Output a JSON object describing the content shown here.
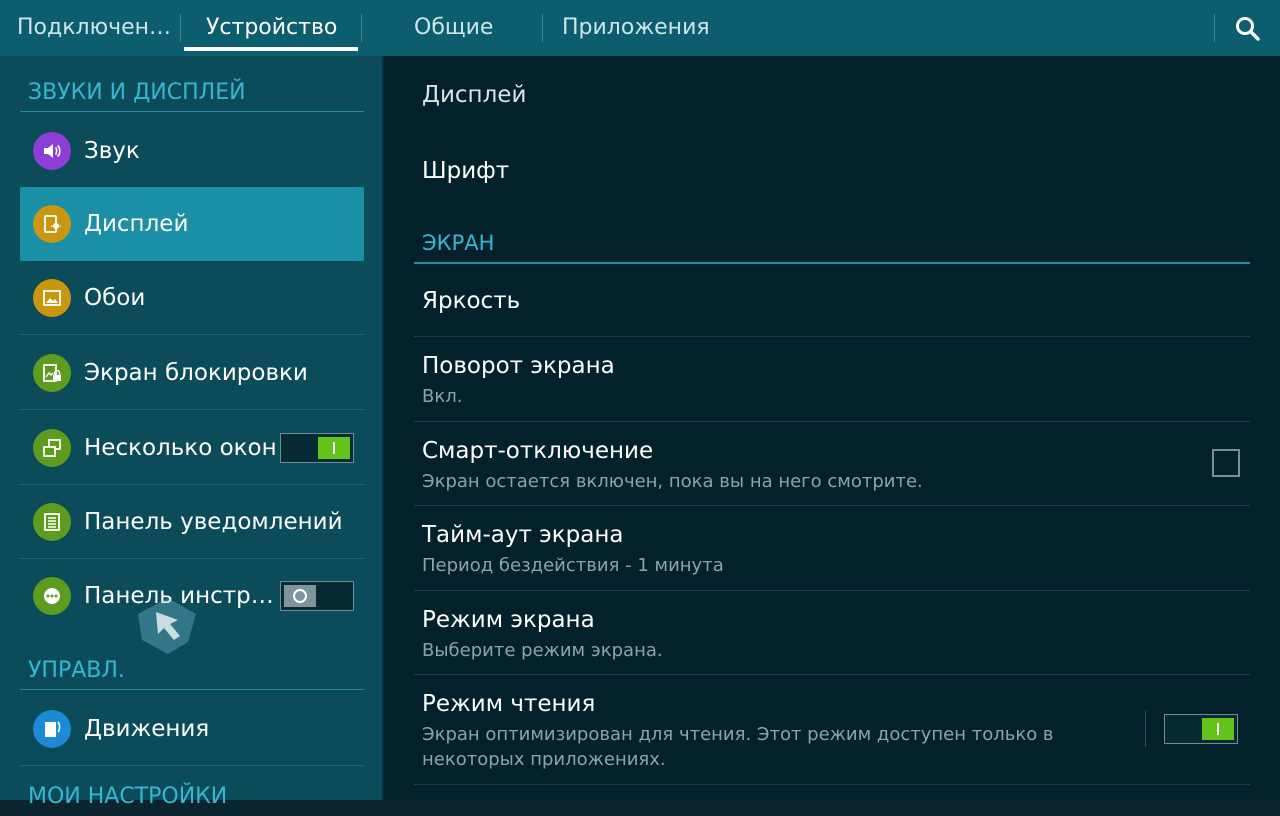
{
  "tabs": [
    {
      "label": "Подключен…",
      "active": false
    },
    {
      "label": "Устройство",
      "active": true
    },
    {
      "label": "Общие",
      "active": false
    },
    {
      "label": "Приложения",
      "active": false
    }
  ],
  "search_icon": "search-icon",
  "sidebar": {
    "sections": [
      "ЗВУКИ И ДИСПЛЕЙ",
      "УПРАВЛ.",
      "МОИ НАСТРОЙКИ"
    ],
    "items": [
      {
        "label": "Звук",
        "icon": "speaker-icon",
        "icon_color": "#8e3ed6"
      },
      {
        "label": "Дисплей",
        "icon": "display-icon",
        "icon_color": "#c9960f",
        "active": true
      },
      {
        "label": "Обои",
        "icon": "wallpaper-icon",
        "icon_color": "#c9960f"
      },
      {
        "label": "Экран блокировки",
        "icon": "lock-screen-icon",
        "icon_color": "#5e9b1e"
      },
      {
        "label": "Несколько окон",
        "icon": "multi-window-icon",
        "icon_color": "#5e9b1e",
        "switch": "on"
      },
      {
        "label": "Панель уведомлений",
        "icon": "notification-panel-icon",
        "icon_color": "#5e9b1e"
      },
      {
        "label": "Панель инстр…",
        "icon": "toolbox-icon",
        "icon_color": "#5e9b1e",
        "switch": "off"
      },
      {
        "label": "Движения",
        "icon": "motions-icon",
        "icon_color": "#1d8ad6"
      }
    ]
  },
  "main": {
    "items_top": [
      {
        "title": "Дисплей"
      },
      {
        "title": "Шрифт"
      }
    ],
    "section": "ЭКРАН",
    "settings": [
      {
        "title": "Яркость",
        "subtitle": ""
      },
      {
        "title": "Поворот экрана",
        "subtitle": "Вкл."
      },
      {
        "title": "Смарт-отключение",
        "subtitle": "Экран остается включен, пока вы на него смотрите.",
        "checkbox": false
      },
      {
        "title": "Тайм-аут экрана",
        "subtitle": "Период бездействия - 1 минута"
      },
      {
        "title": "Режим экрана",
        "subtitle": "Выберите режим экрана."
      },
      {
        "title": "Режим чтения",
        "subtitle": "Экран оптимизирован для чтения. Этот режим доступен только в некоторых приложениях.",
        "switch": "on"
      }
    ]
  },
  "colors": {
    "accent": "#36b7d1",
    "tabbar": "#0c5e6e",
    "sidebar_bg": "#0c4b5a",
    "content_bg": "#03212b",
    "selected": "#1b8fa5",
    "switch_on": "#62c31d"
  }
}
